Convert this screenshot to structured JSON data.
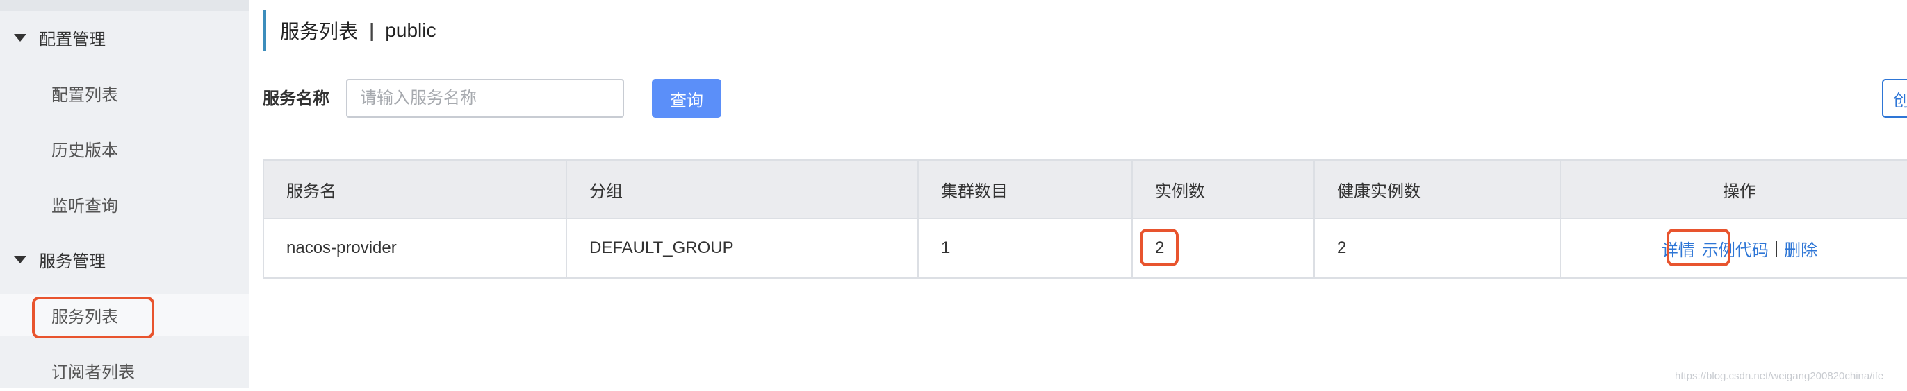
{
  "sidebar": {
    "groups": [
      {
        "label": "配置管理",
        "items": [
          "配置列表",
          "历史版本",
          "监听查询"
        ]
      },
      {
        "label": "服务管理",
        "items": [
          "服务列表",
          "订阅者列表"
        ]
      }
    ],
    "active_item": "服务列表"
  },
  "header": {
    "title": "服务列表",
    "separator": "|",
    "namespace": "public"
  },
  "search": {
    "label": "服务名称",
    "placeholder": "请输入服务名称",
    "value": "",
    "query_label": "查询",
    "create_label": "创"
  },
  "table": {
    "columns": [
      "服务名",
      "分组",
      "集群数目",
      "实例数",
      "健康实例数",
      "操作"
    ],
    "rows": [
      {
        "service_name": "nacos-provider",
        "group": "DEFAULT_GROUP",
        "cluster_count": "1",
        "instance_count": "2",
        "healthy_instance_count": "2",
        "actions": {
          "detail": "详情",
          "sample_code": "示例代码",
          "separator": "|",
          "delete": "删除"
        }
      }
    ]
  },
  "watermark": "https://blog.csdn.net/weigang200820china/ife",
  "colors": {
    "accent": "#5b8ff9",
    "link": "#2e76d6",
    "annotation": "#e8542e",
    "title_bar": "#3c8dbc"
  }
}
